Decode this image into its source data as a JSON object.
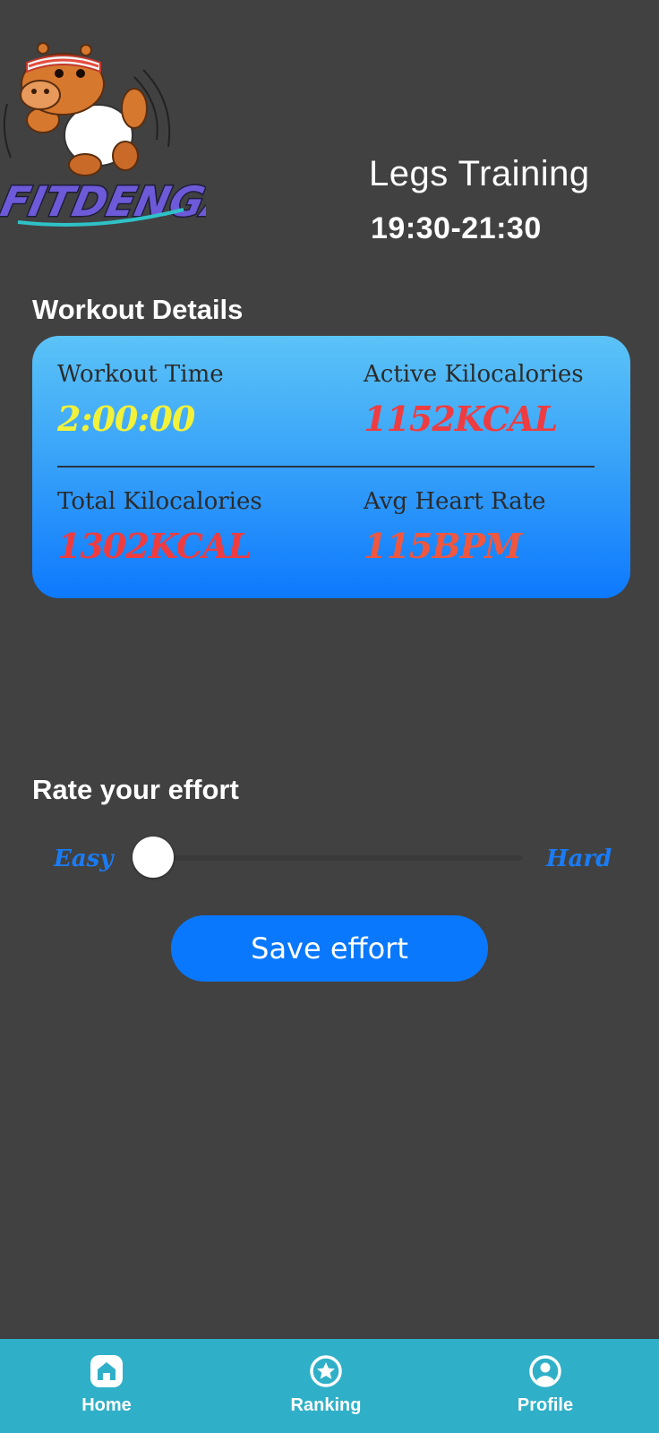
{
  "logo": {
    "text": "FITDENGAI"
  },
  "header": {
    "title": "Legs Training",
    "time_range": "19:30-21:30"
  },
  "workout_details": {
    "section_title": "Workout Details",
    "stats": [
      {
        "label": "Workout Time",
        "value": "2:00:00",
        "color": "#f2f23a"
      },
      {
        "label": "Active Kilocalories",
        "value": "1152KCAL",
        "color": "#ee3c40"
      },
      {
        "label": "Total Kilocalories",
        "value": "1302KCAL",
        "color": "#ee3c40"
      },
      {
        "label": "Avg Heart Rate",
        "value": "115BPM",
        "color": "#f0573f"
      }
    ]
  },
  "effort": {
    "section_title": "Rate your effort",
    "min_label": "Easy",
    "max_label": "Hard",
    "value": 0,
    "save_label": "Save effort"
  },
  "bottom_nav": {
    "items": [
      {
        "label": "Home",
        "icon": "home-icon",
        "active": true
      },
      {
        "label": "Ranking",
        "icon": "star-circle-icon",
        "active": false
      },
      {
        "label": "Profile",
        "icon": "user-circle-icon",
        "active": false
      }
    ]
  },
  "colors": {
    "background": "#414141",
    "accent": "#0a78fd",
    "nav_background": "#2fb0c8",
    "card_gradient_top": "#5bc3f7",
    "card_gradient_bottom": "#0d79fd"
  }
}
